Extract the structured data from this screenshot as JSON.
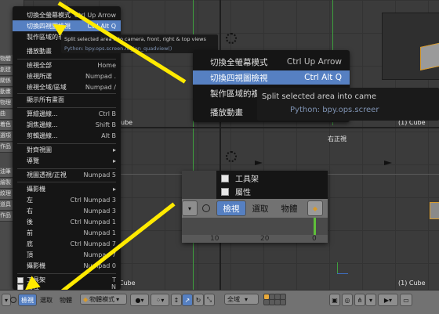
{
  "viewports": {
    "label_cube_top": "(1) Cube",
    "label_cube_bottom_left": "(1) Cube",
    "label_cube_bottom_right": "(1) Cube",
    "label_right_view": "右正視"
  },
  "shelf": {
    "tabs": [
      "物體",
      "創建",
      "關係",
      "動畫",
      "物理",
      "曲",
      "着色",
      "選項",
      "作品",
      "油筆",
      "繪製",
      "紋理",
      "道具",
      "作品"
    ]
  },
  "view_menu": {
    "items": [
      {
        "label": "切換全螢幕模式",
        "shortcut": "Ctrl Up Arrow"
      },
      {
        "label": "切換四視圖檢視",
        "shortcut": "Ctrl Alt Q",
        "selected": true
      },
      {
        "label": "製作區域的非",
        "shortcut": ""
      },
      {
        "label": "播放動畫",
        "shortcut": ""
      },
      {
        "label": "檢視全部",
        "shortcut": "Home"
      },
      {
        "label": "檢視所選",
        "shortcut": "Numpad ."
      },
      {
        "label": "檢視全域/區域",
        "shortcut": "Numpad /"
      },
      {
        "label": "顯示所有畫面",
        "shortcut": ""
      },
      {
        "label": "算繪邊線...",
        "shortcut": "Ctrl B"
      },
      {
        "label": "調焦邊線...",
        "shortcut": "Shift B"
      },
      {
        "label": "剪輯邊線...",
        "shortcut": "Alt B"
      },
      {
        "label": "對齊視圖",
        "shortcut": ""
      },
      {
        "label": "導覽",
        "shortcut": ""
      },
      {
        "label": "視圖透視/正視",
        "shortcut": "Numpad 5"
      },
      {
        "label": "攝影機",
        "shortcut": ""
      },
      {
        "label": "左",
        "shortcut": "Ctrl Numpad 3"
      },
      {
        "label": "右",
        "shortcut": "Numpad 3"
      },
      {
        "label": "後",
        "shortcut": "Ctrl Numpad 1"
      },
      {
        "label": "前",
        "shortcut": "Numpad 1"
      },
      {
        "label": "底",
        "shortcut": "Ctrl Numpad 7"
      },
      {
        "label": "頂",
        "shortcut": "Numpad 7"
      },
      {
        "label": "攝影機",
        "shortcut": "Numpad 0"
      },
      {
        "label": "工具架",
        "shortcut": "T"
      },
      {
        "label": "屬性",
        "shortcut": "N"
      }
    ]
  },
  "tooltip_small": {
    "text": "Split selected area into camera, front, right & top views",
    "python": "Python: bpy.ops.screen.region_quadview()"
  },
  "zoom_menu": {
    "items": [
      {
        "label": "切換全螢幕模式",
        "shortcut": "Ctrl Up Arrow"
      },
      {
        "label": "切換四視圖檢視",
        "shortcut": "Ctrl Alt Q",
        "selected": true
      },
      {
        "label": "製作區域的複",
        "shortcut": ""
      },
      {
        "label": "播放動畫",
        "shortcut": ""
      }
    ]
  },
  "tooltip_zoom": {
    "text": "Split selected area into came",
    "python": "Python: bpy.ops.screer"
  },
  "zoom_header": {
    "menu_items": [
      "工具架",
      "屬性"
    ],
    "tabs": [
      "檢視",
      "選取",
      "物體"
    ],
    "ruler": [
      "10",
      "20",
      "0"
    ]
  },
  "header": {
    "tab_view": "檢視",
    "tab_select": "選取",
    "tab_object": "物體",
    "mode": "物體模式",
    "global": "全域"
  },
  "colors": {
    "accent": "#5680c2",
    "arrow": "#ffea00",
    "menu_bg": "#151515"
  }
}
